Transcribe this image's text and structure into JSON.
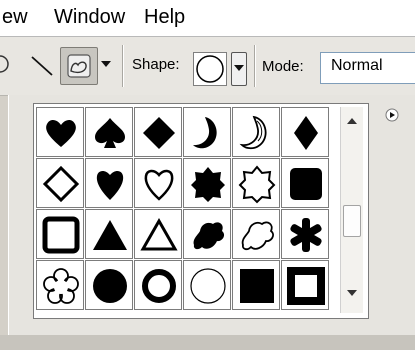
{
  "menu": {
    "items": [
      {
        "label": "ew"
      },
      {
        "label": "Window"
      },
      {
        "label": "Help"
      }
    ]
  },
  "options_bar": {
    "shape_label": "Shape:",
    "mode_label": "Mode:",
    "mode_value": "Normal"
  },
  "shapes": [
    {
      "name": "heart"
    },
    {
      "name": "spade"
    },
    {
      "name": "diamond"
    },
    {
      "name": "crescent-moon"
    },
    {
      "name": "crescent-moon-outline"
    },
    {
      "name": "diamond-tall"
    },
    {
      "name": "diamond-outline"
    },
    {
      "name": "heart-filled"
    },
    {
      "name": "heart-outline"
    },
    {
      "name": "badge-8"
    },
    {
      "name": "badge-8-outline"
    },
    {
      "name": "rounded-square"
    },
    {
      "name": "square-frame"
    },
    {
      "name": "triangle"
    },
    {
      "name": "triangle-outline"
    },
    {
      "name": "blob"
    },
    {
      "name": "blob-outline"
    },
    {
      "name": "asterisk"
    },
    {
      "name": "flower-outline"
    },
    {
      "name": "circle"
    },
    {
      "name": "ring"
    },
    {
      "name": "circle-outline"
    },
    {
      "name": "square"
    },
    {
      "name": "square-frame-thick"
    }
  ],
  "colors": {
    "menu_bg": "#ffffff",
    "toolbar_bg": "#e8e6e1",
    "panel_bg": "#e6e4df"
  }
}
